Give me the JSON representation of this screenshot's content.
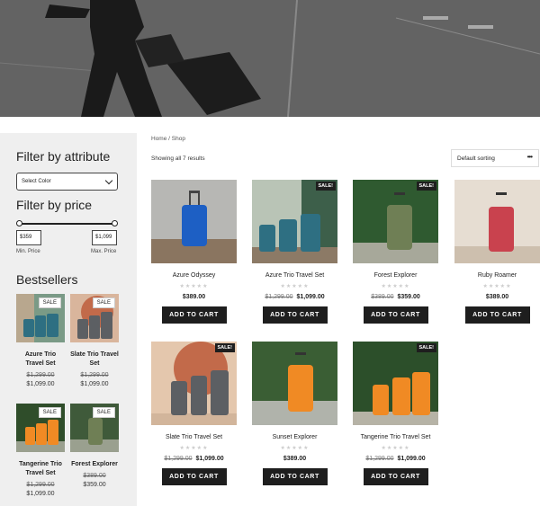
{
  "sidebar": {
    "filter_attr_heading": "Filter by attribute",
    "color_select_placeholder": "Select Color",
    "filter_price_heading": "Filter by price",
    "min_price": "$359",
    "max_price": "$1,099",
    "min_label": "Min. Price",
    "max_label": "Max. Price",
    "bestsellers_heading": "Bestsellers",
    "bestsellers": [
      {
        "name": "Azure Trio Travel Set",
        "old_price": "$1,299.00",
        "price": "$1,099.00",
        "badge": "SALE"
      },
      {
        "name": "Slate Trio Travel Set",
        "old_price": "$1,299.00",
        "price": "$1,099.00",
        "badge": "SALE"
      },
      {
        "name": "Tangerine Trio Travel Set",
        "old_price": "$1,299.00",
        "price": "$1,099.00",
        "badge": "SALE"
      },
      {
        "name": "Forest Explorer",
        "old_price": "$389.00",
        "price": "$359.00",
        "badge": "SALE"
      }
    ]
  },
  "main": {
    "breadcrumb": "Home / Shop",
    "result_count": "Showing all 7 results",
    "sort_label": "Default sorting",
    "products": [
      {
        "name": "Azure Odyssey",
        "price": "$389.00",
        "old_price": "",
        "sale": "",
        "cart": "ADD TO CART"
      },
      {
        "name": "Azure Trio Travel Set",
        "price": "$1,099.00",
        "old_price": "$1,299.00",
        "sale": "SALE!",
        "cart": "ADD TO CART"
      },
      {
        "name": "Forest Explorer",
        "price": "$359.00",
        "old_price": "$389.00",
        "sale": "SALE!",
        "cart": "ADD TO CART"
      },
      {
        "name": "Ruby Roamer",
        "price": "$389.00",
        "old_price": "",
        "sale": "",
        "cart": "ADD TO CART"
      },
      {
        "name": "Slate Trio Travel Set",
        "price": "$1,099.00",
        "old_price": "$1,299.00",
        "sale": "SALE!",
        "cart": "ADD TO CART"
      },
      {
        "name": "Sunset Explorer",
        "price": "$389.00",
        "old_price": "",
        "sale": "",
        "cart": "ADD TO CART"
      },
      {
        "name": "Tangerine Trio Travel Set",
        "price": "$1,099.00",
        "old_price": "$1,299.00",
        "sale": "SALE!",
        "cart": "ADD TO CART"
      }
    ]
  },
  "stars": "★★★★★",
  "colors": {
    "accent": "#1e1e1e",
    "sidebar_bg": "#efefef",
    "blue": "#1d5fc4",
    "teal": "#2e6f82",
    "green": "#6f7f55",
    "red": "#c9424e",
    "slate": "#5c5f63",
    "orange": "#f08a24"
  }
}
